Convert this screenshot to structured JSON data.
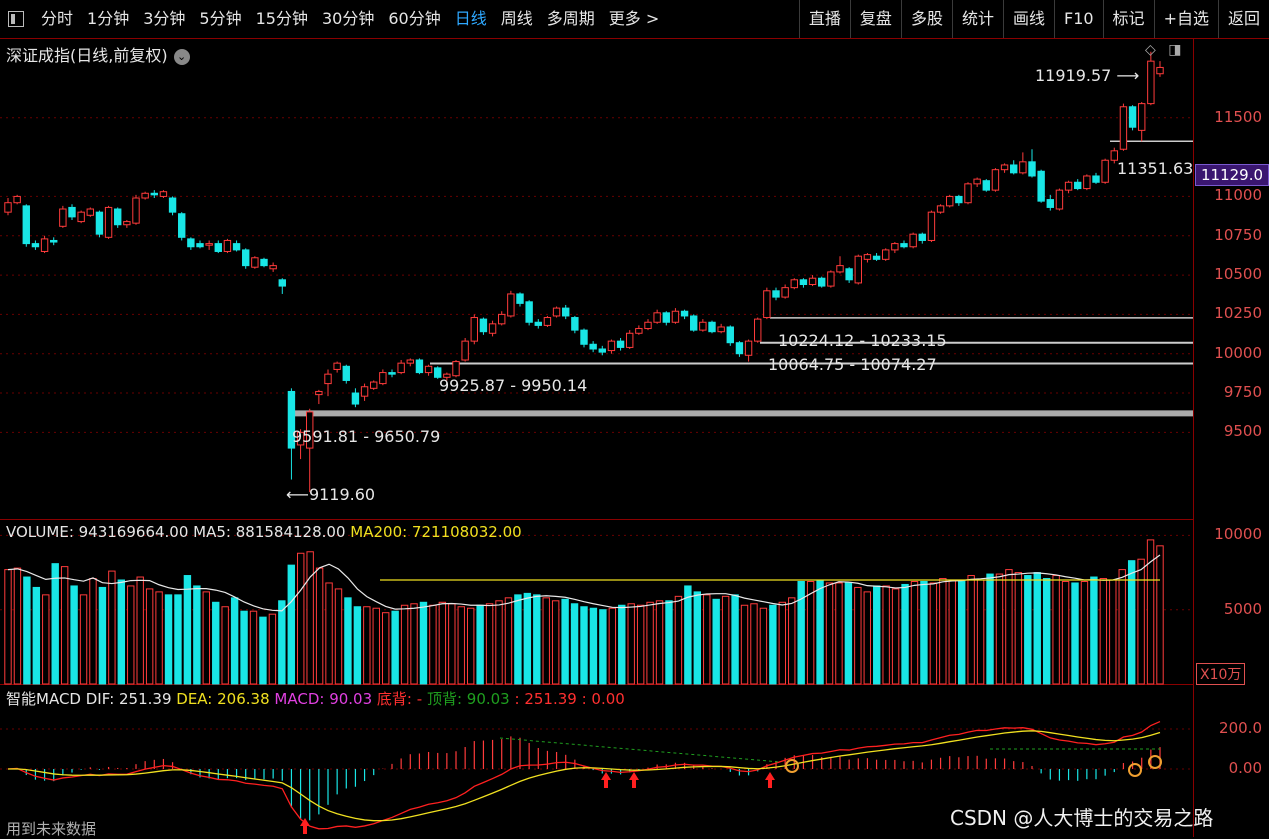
{
  "toolbar": {
    "left_items": [
      {
        "label": "分时"
      },
      {
        "label": "1分钟"
      },
      {
        "label": "3分钟"
      },
      {
        "label": "5分钟"
      },
      {
        "label": "15分钟"
      },
      {
        "label": "30分钟"
      },
      {
        "label": "60分钟"
      },
      {
        "label": "日线",
        "active": true
      },
      {
        "label": "周线"
      },
      {
        "label": "多周期"
      },
      {
        "label": "更多 >"
      }
    ],
    "right_items": [
      {
        "label": "直播"
      },
      {
        "label": "复盘"
      },
      {
        "label": "多股"
      },
      {
        "label": "统计"
      },
      {
        "label": "画线"
      },
      {
        "label": "F10"
      },
      {
        "label": "标记"
      },
      {
        "label": "+自选"
      },
      {
        "label": "返回"
      }
    ]
  },
  "chart": {
    "title": "深证成指(日线,前复权)",
    "price_axis": [
      "11500",
      "11000",
      "10750",
      "10500",
      "10250",
      "10000",
      "9750",
      "9500"
    ],
    "current_price": "11129.0",
    "annotations": {
      "high": "11919.57",
      "low": "9119.60",
      "gap_a": "9591.81 - 9650.79",
      "gap_b": "9925.87 - 9950.14",
      "gap_c": "10064.75 - 10074.27",
      "gap_d": "10224.12 - 10233.15",
      "support": "11351.63"
    }
  },
  "volume": {
    "label": "VOLUME: 943169664.00",
    "ma5": "MA5: 881584128.00",
    "ma200": "MA200: 721108032.00",
    "axis": [
      "10000",
      "5000"
    ],
    "unit": "X10万"
  },
  "macd": {
    "name": "智能MACD",
    "dif": "DIF: 251.39",
    "dea": "DEA: 206.38",
    "macd": "MACD: 90.03",
    "bottom_div": "底背: -",
    "top_div": "顶背: 90.03",
    "extra": ": 251.39 : 0.00",
    "axis": [
      "200.0",
      "0.00"
    ]
  },
  "footer": {
    "future_data": "用到未来数据",
    "watermark": "CSDN @人大博士的交易之路"
  },
  "colors": {
    "up": "#ff3b3b",
    "down": "#19e6e6",
    "grid": "#8a0000",
    "ma200": "#f0e020"
  },
  "chart_data": {
    "type": "candlestick",
    "candles": [
      {
        "o": 10900,
        "c": 10960,
        "h": 10990,
        "l": 10880
      },
      {
        "o": 10960,
        "c": 11000,
        "h": 11010,
        "l": 10950
      },
      {
        "o": 10940,
        "c": 10700,
        "h": 10950,
        "l": 10680
      },
      {
        "o": 10700,
        "c": 10680,
        "h": 10720,
        "l": 10660
      },
      {
        "o": 10650,
        "c": 10730,
        "h": 10750,
        "l": 10640
      },
      {
        "o": 10720,
        "c": 10710,
        "h": 10740,
        "l": 10690
      },
      {
        "o": 10810,
        "c": 10920,
        "h": 10940,
        "l": 10800
      },
      {
        "o": 10930,
        "c": 10870,
        "h": 10950,
        "l": 10850
      },
      {
        "o": 10840,
        "c": 10900,
        "h": 10910,
        "l": 10830
      },
      {
        "o": 10880,
        "c": 10920,
        "h": 10930,
        "l": 10870
      },
      {
        "o": 10900,
        "c": 10760,
        "h": 10910,
        "l": 10740
      },
      {
        "o": 10740,
        "c": 10930,
        "h": 10940,
        "l": 10730
      },
      {
        "o": 10920,
        "c": 10820,
        "h": 10930,
        "l": 10800
      },
      {
        "o": 10820,
        "c": 10840,
        "h": 10850,
        "l": 10800
      },
      {
        "o": 10830,
        "c": 10990,
        "h": 11010,
        "l": 10820
      },
      {
        "o": 10990,
        "c": 11020,
        "h": 11030,
        "l": 10980
      },
      {
        "o": 11020,
        "c": 11010,
        "h": 11040,
        "l": 10990
      },
      {
        "o": 11000,
        "c": 11030,
        "h": 11040,
        "l": 10990
      },
      {
        "o": 10990,
        "c": 10900,
        "h": 11000,
        "l": 10880
      },
      {
        "o": 10890,
        "c": 10740,
        "h": 10900,
        "l": 10720
      },
      {
        "o": 10730,
        "c": 10680,
        "h": 10740,
        "l": 10660
      },
      {
        "o": 10700,
        "c": 10680,
        "h": 10720,
        "l": 10670
      },
      {
        "o": 10690,
        "c": 10700,
        "h": 10720,
        "l": 10660
      },
      {
        "o": 10700,
        "c": 10650,
        "h": 10720,
        "l": 10640
      },
      {
        "o": 10650,
        "c": 10720,
        "h": 10730,
        "l": 10640
      },
      {
        "o": 10700,
        "c": 10660,
        "h": 10720,
        "l": 10650
      },
      {
        "o": 10660,
        "c": 10560,
        "h": 10670,
        "l": 10540
      },
      {
        "o": 10550,
        "c": 10610,
        "h": 10620,
        "l": 10540
      },
      {
        "o": 10600,
        "c": 10560,
        "h": 10610,
        "l": 10550
      },
      {
        "o": 10540,
        "c": 10560,
        "h": 10580,
        "l": 10520
      },
      {
        "o": 10470,
        "c": 10430,
        "h": 10480,
        "l": 10380
      },
      {
        "o": 9760,
        "c": 9400,
        "h": 9780,
        "l": 9200
      },
      {
        "o": 9420,
        "c": 9500,
        "h": 9520,
        "l": 9330
      },
      {
        "o": 9400,
        "c": 9630,
        "h": 9650,
        "l": 9120
      },
      {
        "o": 9740,
        "c": 9760,
        "h": 9770,
        "l": 9680
      },
      {
        "o": 9810,
        "c": 9870,
        "h": 9900,
        "l": 9730
      },
      {
        "o": 9900,
        "c": 9940,
        "h": 9950,
        "l": 9880
      },
      {
        "o": 9920,
        "c": 9830,
        "h": 9930,
        "l": 9810
      },
      {
        "o": 9750,
        "c": 9680,
        "h": 9780,
        "l": 9660
      },
      {
        "o": 9730,
        "c": 9790,
        "h": 9810,
        "l": 9700
      },
      {
        "o": 9780,
        "c": 9820,
        "h": 9830,
        "l": 9770
      },
      {
        "o": 9810,
        "c": 9880,
        "h": 9900,
        "l": 9800
      },
      {
        "o": 9880,
        "c": 9870,
        "h": 9900,
        "l": 9850
      },
      {
        "o": 9880,
        "c": 9940,
        "h": 9960,
        "l": 9870
      },
      {
        "o": 9940,
        "c": 9960,
        "h": 9970,
        "l": 9920
      },
      {
        "o": 9960,
        "c": 9880,
        "h": 9970,
        "l": 9870
      },
      {
        "o": 9880,
        "c": 9920,
        "h": 9930,
        "l": 9860
      },
      {
        "o": 9910,
        "c": 9850,
        "h": 9920,
        "l": 9840
      },
      {
        "o": 9850,
        "c": 9870,
        "h": 9880,
        "l": 9830
      },
      {
        "o": 9860,
        "c": 9950,
        "h": 9960,
        "l": 9850
      },
      {
        "o": 9960,
        "c": 10080,
        "h": 10100,
        "l": 9950
      },
      {
        "o": 10080,
        "c": 10230,
        "h": 10250,
        "l": 10060
      },
      {
        "o": 10220,
        "c": 10140,
        "h": 10230,
        "l": 10120
      },
      {
        "o": 10130,
        "c": 10190,
        "h": 10210,
        "l": 10110
      },
      {
        "o": 10190,
        "c": 10250,
        "h": 10270,
        "l": 10180
      },
      {
        "o": 10240,
        "c": 10380,
        "h": 10400,
        "l": 10230
      },
      {
        "o": 10380,
        "c": 10320,
        "h": 10390,
        "l": 10300
      },
      {
        "o": 10330,
        "c": 10200,
        "h": 10340,
        "l": 10180
      },
      {
        "o": 10200,
        "c": 10180,
        "h": 10220,
        "l": 10160
      },
      {
        "o": 10180,
        "c": 10230,
        "h": 10240,
        "l": 10170
      },
      {
        "o": 10240,
        "c": 10290,
        "h": 10300,
        "l": 10230
      },
      {
        "o": 10290,
        "c": 10240,
        "h": 10310,
        "l": 10220
      },
      {
        "o": 10230,
        "c": 10150,
        "h": 10240,
        "l": 10130
      },
      {
        "o": 10150,
        "c": 10060,
        "h": 10160,
        "l": 10040
      },
      {
        "o": 10060,
        "c": 10030,
        "h": 10080,
        "l": 10010
      },
      {
        "o": 10030,
        "c": 10010,
        "h": 10050,
        "l": 9990
      },
      {
        "o": 10020,
        "c": 10080,
        "h": 10090,
        "l": 10000
      },
      {
        "o": 10080,
        "c": 10040,
        "h": 10100,
        "l": 10020
      },
      {
        "o": 10040,
        "c": 10130,
        "h": 10150,
        "l": 10030
      },
      {
        "o": 10130,
        "c": 10160,
        "h": 10180,
        "l": 10120
      },
      {
        "o": 10160,
        "c": 10200,
        "h": 10220,
        "l": 10150
      },
      {
        "o": 10200,
        "c": 10260,
        "h": 10280,
        "l": 10190
      },
      {
        "o": 10260,
        "c": 10200,
        "h": 10270,
        "l": 10180
      },
      {
        "o": 10200,
        "c": 10270,
        "h": 10290,
        "l": 10190
      },
      {
        "o": 10270,
        "c": 10240,
        "h": 10280,
        "l": 10220
      },
      {
        "o": 10240,
        "c": 10150,
        "h": 10250,
        "l": 10140
      },
      {
        "o": 10150,
        "c": 10200,
        "h": 10220,
        "l": 10140
      },
      {
        "o": 10200,
        "c": 10140,
        "h": 10210,
        "l": 10130
      },
      {
        "o": 10140,
        "c": 10170,
        "h": 10190,
        "l": 10130
      },
      {
        "o": 10170,
        "c": 10070,
        "h": 10180,
        "l": 10050
      },
      {
        "o": 10070,
        "c": 10000,
        "h": 10080,
        "l": 9980
      },
      {
        "o": 9990,
        "c": 10080,
        "h": 10090,
        "l": 9950
      },
      {
        "o": 10080,
        "c": 10220,
        "h": 10230,
        "l": 10070
      },
      {
        "o": 10230,
        "c": 10400,
        "h": 10420,
        "l": 10220
      },
      {
        "o": 10400,
        "c": 10360,
        "h": 10420,
        "l": 10340
      },
      {
        "o": 10360,
        "c": 10420,
        "h": 10440,
        "l": 10350
      },
      {
        "o": 10420,
        "c": 10470,
        "h": 10480,
        "l": 10410
      },
      {
        "o": 10470,
        "c": 10440,
        "h": 10480,
        "l": 10420
      },
      {
        "o": 10440,
        "c": 10480,
        "h": 10500,
        "l": 10430
      },
      {
        "o": 10480,
        "c": 10430,
        "h": 10490,
        "l": 10420
      },
      {
        "o": 10430,
        "c": 10520,
        "h": 10530,
        "l": 10420
      },
      {
        "o": 10520,
        "c": 10560,
        "h": 10620,
        "l": 10510
      },
      {
        "o": 10540,
        "c": 10470,
        "h": 10550,
        "l": 10450
      },
      {
        "o": 10450,
        "c": 10620,
        "h": 10630,
        "l": 10440
      },
      {
        "o": 10600,
        "c": 10630,
        "h": 10640,
        "l": 10580
      },
      {
        "o": 10620,
        "c": 10600,
        "h": 10640,
        "l": 10590
      },
      {
        "o": 10600,
        "c": 10660,
        "h": 10670,
        "l": 10590
      },
      {
        "o": 10660,
        "c": 10700,
        "h": 10710,
        "l": 10640
      },
      {
        "o": 10700,
        "c": 10680,
        "h": 10720,
        "l": 10670
      },
      {
        "o": 10680,
        "c": 10760,
        "h": 10770,
        "l": 10670
      },
      {
        "o": 10760,
        "c": 10720,
        "h": 10770,
        "l": 10700
      },
      {
        "o": 10720,
        "c": 10900,
        "h": 10910,
        "l": 10710
      },
      {
        "o": 10900,
        "c": 10940,
        "h": 10950,
        "l": 10890
      },
      {
        "o": 10940,
        "c": 11000,
        "h": 11010,
        "l": 10930
      },
      {
        "o": 11000,
        "c": 10960,
        "h": 11010,
        "l": 10940
      },
      {
        "o": 10960,
        "c": 11080,
        "h": 11090,
        "l": 10950
      },
      {
        "o": 11080,
        "c": 11110,
        "h": 11120,
        "l": 11060
      },
      {
        "o": 11100,
        "c": 11040,
        "h": 11110,
        "l": 11030
      },
      {
        "o": 11040,
        "c": 11170,
        "h": 11180,
        "l": 11030
      },
      {
        "o": 11170,
        "c": 11200,
        "h": 11210,
        "l": 11150
      },
      {
        "o": 11200,
        "c": 11150,
        "h": 11230,
        "l": 11140
      },
      {
        "o": 11150,
        "c": 11220,
        "h": 11280,
        "l": 11140
      },
      {
        "o": 11220,
        "c": 11130,
        "h": 11300,
        "l": 11120
      },
      {
        "o": 11160,
        "c": 10970,
        "h": 11170,
        "l": 10960
      },
      {
        "o": 10980,
        "c": 10930,
        "h": 11010,
        "l": 10910
      },
      {
        "o": 10920,
        "c": 11040,
        "h": 11050,
        "l": 10910
      },
      {
        "o": 11040,
        "c": 11090,
        "h": 11100,
        "l": 11020
      },
      {
        "o": 11090,
        "c": 11050,
        "h": 11110,
        "l": 11040
      },
      {
        "o": 11050,
        "c": 11130,
        "h": 11140,
        "l": 11040
      },
      {
        "o": 11130,
        "c": 11090,
        "h": 11150,
        "l": 11080
      },
      {
        "o": 11090,
        "c": 11230,
        "h": 11240,
        "l": 11080
      },
      {
        "o": 11230,
        "c": 11290,
        "h": 11310,
        "l": 11210
      },
      {
        "o": 11300,
        "c": 11570,
        "h": 11590,
        "l": 11290
      },
      {
        "o": 11570,
        "c": 11440,
        "h": 11580,
        "l": 11420
      },
      {
        "o": 11420,
        "c": 11590,
        "h": 11600,
        "l": 11350
      },
      {
        "o": 11590,
        "c": 11860,
        "h": 11920,
        "l": 11580
      },
      {
        "o": 11780,
        "c": 11820,
        "h": 11860,
        "l": 11760
      }
    ],
    "volume": [
      7700,
      7800,
      7200,
      6500,
      6000,
      8100,
      7900,
      6600,
      6000,
      7100,
      6500,
      7600,
      7000,
      6600,
      7200,
      6400,
      6200,
      6000,
      6000,
      7300,
      6600,
      6200,
      5500,
      5200,
      5800,
      4900,
      4900,
      4500,
      4700,
      5600,
      8000,
      8800,
      8900,
      7800,
      6800,
      6400,
      5800,
      5200,
      5200,
      5100,
      4800,
      4900,
      5300,
      5400,
      5500,
      5300,
      5500,
      5400,
      5200,
      5100,
      5300,
      5400,
      5600,
      5800,
      6000,
      6100,
      6000,
      5800,
      5600,
      5700,
      5400,
      5200,
      5100,
      5000,
      5100,
      5300,
      5400,
      5300,
      5500,
      5600,
      5600,
      5900,
      6600,
      6200,
      6000,
      5700,
      5900,
      6000,
      5300,
      5400,
      5100,
      5300,
      5500,
      5800,
      6900,
      6900,
      7000,
      6800,
      6800,
      6800,
      6500,
      6200,
      6600,
      6600,
      6400,
      6700,
      6900,
      6900,
      6800,
      7100,
      7000,
      7000,
      7300,
      7000,
      7400,
      7400,
      7700,
      7500,
      7300,
      7500,
      7100,
      7300,
      6900,
      6800,
      6900,
      7200,
      7100,
      7000,
      7700,
      8300,
      8400,
      9700,
      9300
    ],
    "ma200": 7000,
    "macd": {
      "dif": 251.39,
      "dea": 206.38,
      "macd": 90.03
    },
    "price_range": [
      9000,
      11950
    ],
    "volume_range": [
      0,
      10500
    ]
  }
}
